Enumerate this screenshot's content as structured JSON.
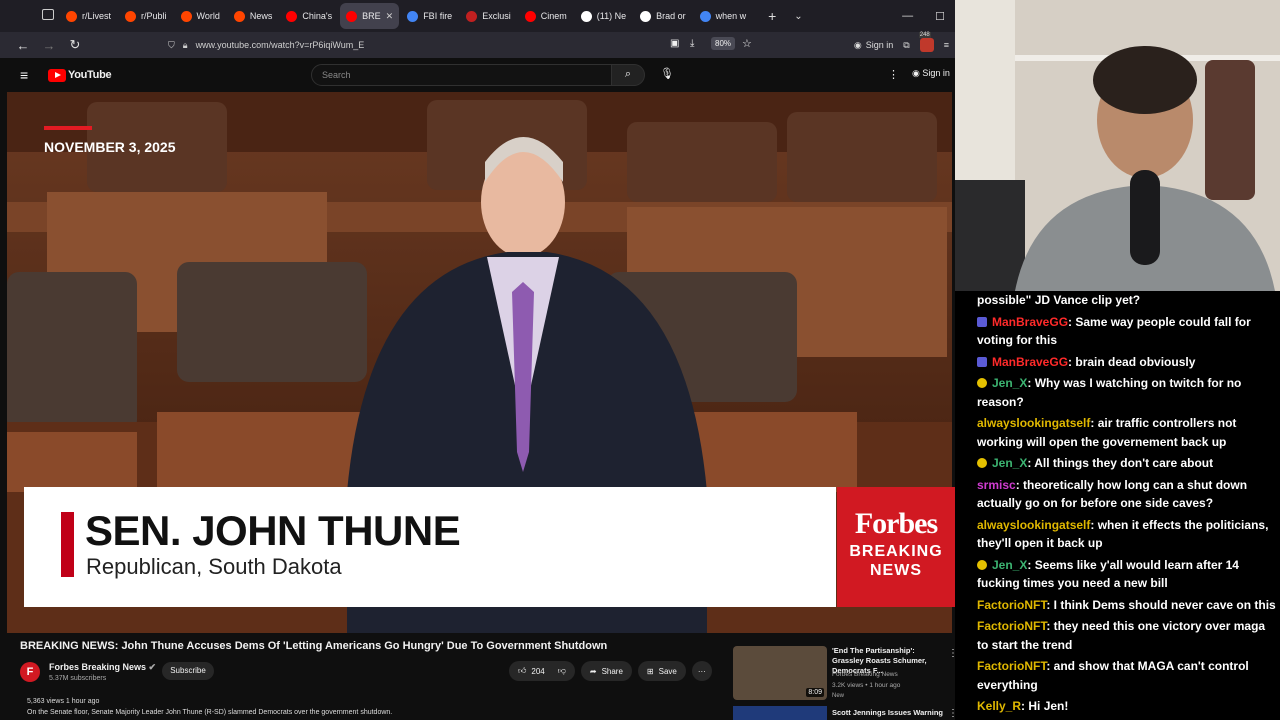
{
  "browser": {
    "tabs": [
      {
        "label": "r/Livest",
        "color": "#ff4500"
      },
      {
        "label": "r/Publi",
        "color": "#ff4500"
      },
      {
        "label": "World",
        "color": "#ff4500"
      },
      {
        "label": "News",
        "color": "#ff4500"
      },
      {
        "label": "China's",
        "color": "#ff0000"
      },
      {
        "label": "BRE",
        "color": "#ff0000"
      },
      {
        "label": "FBI fire",
        "color": "#4285f4"
      },
      {
        "label": "Exclusi",
        "color": "#c02020"
      },
      {
        "label": "Cinem",
        "color": "#ff0000"
      },
      {
        "label": "(11) Ne",
        "color": "#ffffff"
      },
      {
        "label": "Brad or",
        "color": "#ffffff"
      },
      {
        "label": "when w",
        "color": "#4285f4"
      }
    ],
    "active_tab_index": 5,
    "url": "www.youtube.com/watch?v=rP6iqiWum_E",
    "zoom": "80%",
    "sign_in": "Sign in",
    "badge_count": "248"
  },
  "youtube": {
    "logo_text": "YouTube",
    "search_placeholder": "Search",
    "sign_in": "Sign in",
    "video": {
      "date": "NOVEMBER 3, 2025",
      "lower_third_name": "SEN. JOHN THUNE",
      "lower_third_sub": "Republican, South Dakota",
      "brand_1": "Forbes",
      "brand_2": "BREAKING",
      "brand_3": "NEWS"
    },
    "title": "BREAKING NEWS: John Thune Accuses Dems Of 'Letting Americans Go Hungry' Due To Government Shutdown",
    "channel": "Forbes Breaking News",
    "channel_initial": "F",
    "subscribers": "5.37M subscribers",
    "subscribe": "Subscribe",
    "likes": "204",
    "share": "Share",
    "save": "Save",
    "views_time": "5,363 views  1 hour ago",
    "description": "On the Senate floor, Senate Majority Leader John Thune (R-SD) slammed Democrats over the government shutdown.",
    "recommendations": [
      {
        "title": "'End The Partisanship': Grassley Roasts Schumer, Democrats F...",
        "channel": "Forbes Breaking News",
        "meta": "3.2K views • 1 hour ago",
        "new": "New",
        "duration": "8:09"
      },
      {
        "title": "Scott Jennings Issues Warning"
      }
    ]
  },
  "chat": [
    {
      "badge": "",
      "user": "",
      "user_color": "#ffffff",
      "text": "possible\" JD Vance clip yet?"
    },
    {
      "badge": "mod",
      "user": "ManBraveGG",
      "user_color": "#ff2a2a",
      "text": ": Same way people could fall for voting for this"
    },
    {
      "badge": "mod",
      "user": "ManBraveGG",
      "user_color": "#ff2a2a",
      "text": ": brain dead obviously"
    },
    {
      "badge": "sub",
      "user": "Jen_X",
      "user_color": "#3cb371",
      "text": ": Why was I watching on twitch for no reason?"
    },
    {
      "badge": "",
      "user": "alwayslookingatself",
      "user_color": "#e0b800",
      "text": ": air traffic controllers not working will open the governement back up"
    },
    {
      "badge": "sub",
      "user": "Jen_X",
      "user_color": "#3cb371",
      "text": ": All things they don't care about"
    },
    {
      "badge": "",
      "user": "srmisc",
      "user_color": "#d03cd0",
      "text": ": theoretically how long can a shut down actually go on for before one side caves?"
    },
    {
      "badge": "",
      "user": "alwayslookingatself",
      "user_color": "#e0b800",
      "text": ": when it effects the politicians, they'll open it back up"
    },
    {
      "badge": "sub",
      "user": "Jen_X",
      "user_color": "#3cb371",
      "text": ": Seems like y'all would learn after 14 fucking times you need a new bill"
    },
    {
      "badge": "",
      "user": "FactorioNFT",
      "user_color": "#e0b800",
      "text": ": I think Dems should never cave on this"
    },
    {
      "badge": "",
      "user": "FactorioNFT",
      "user_color": "#e0b800",
      "text": ": they need this one victory over maga to start the trend"
    },
    {
      "badge": "",
      "user": "FactorioNFT",
      "user_color": "#e0b800",
      "text": ": and show that MAGA can't control everything"
    },
    {
      "badge": "",
      "user": "Kelly_R",
      "user_color": "#e0b800",
      "text": ": Hi Jen!"
    }
  ]
}
